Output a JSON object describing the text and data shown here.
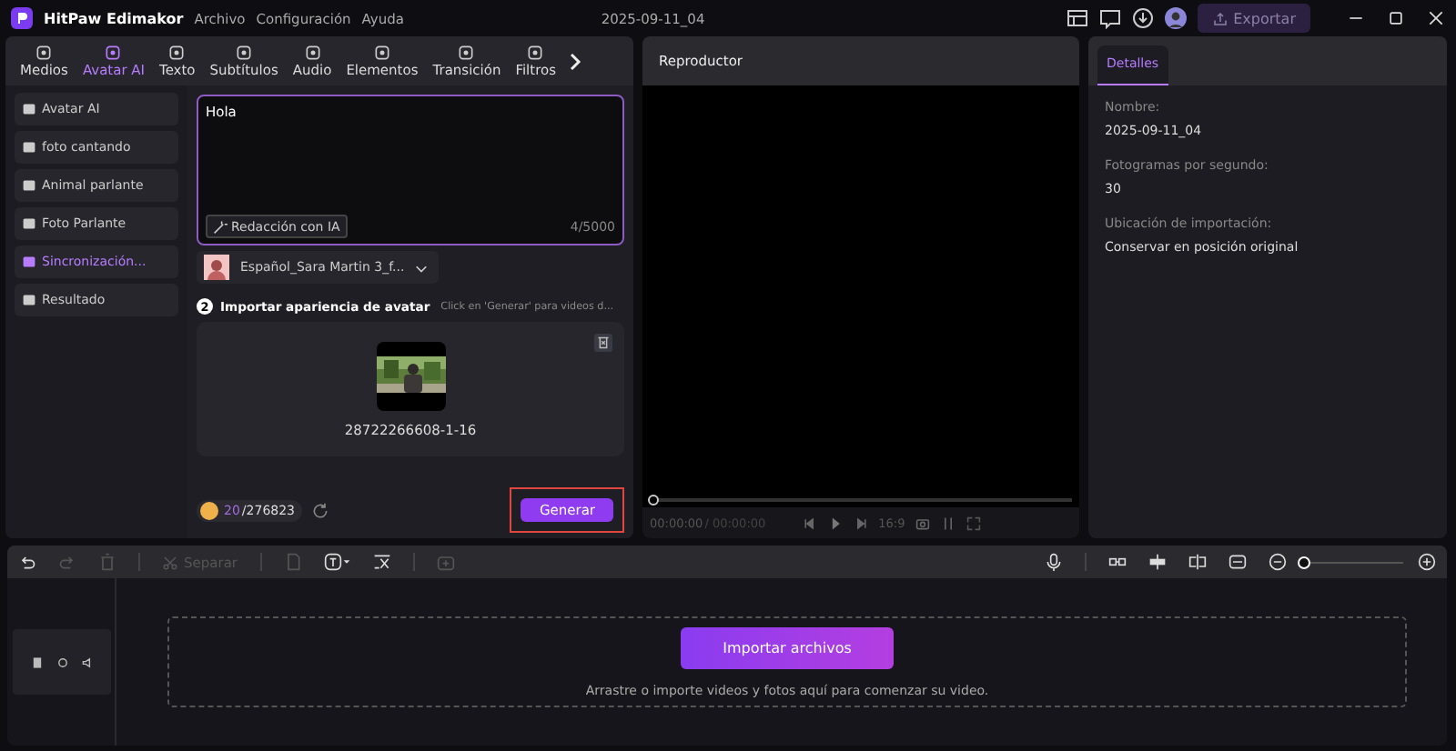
{
  "app": {
    "name": "HitPaw Edimakor",
    "menu": [
      "Archivo",
      "Configuración",
      "Ayuda"
    ],
    "project": "2025-09-11_04",
    "export": "Exportar"
  },
  "tabs": [
    {
      "label": "Medios",
      "selected": false
    },
    {
      "label": "Avatar AI",
      "selected": true
    },
    {
      "label": "Texto",
      "selected": false
    },
    {
      "label": "Subtítulos",
      "selected": false
    },
    {
      "label": "Audio",
      "selected": false
    },
    {
      "label": "Elementos",
      "selected": false
    },
    {
      "label": "Transición",
      "selected": false
    },
    {
      "label": "Filtros",
      "selected": false
    }
  ],
  "sidebar": [
    {
      "label": "Avatar AI",
      "selected": false
    },
    {
      "label": "foto cantando",
      "selected": false
    },
    {
      "label": "Animal parlante",
      "selected": false
    },
    {
      "label": "Foto Parlante",
      "selected": false
    },
    {
      "label": "Sincronización...",
      "selected": true
    },
    {
      "label": "Resultado",
      "selected": false
    }
  ],
  "script": {
    "value": "Hola",
    "ai_button": "Redacción con IA",
    "count": "4/5000"
  },
  "voice": {
    "name": "Español_Sara Martin 3_f..."
  },
  "step": {
    "number": "2",
    "title": "Importar apariencia de avatar",
    "hint": "Click en 'Generar' para videos d..."
  },
  "media": {
    "kind": "picture",
    "filename": "28722266608-1-16"
  },
  "credits": {
    "used": "20",
    "total": "/276823"
  },
  "generate": "Generar",
  "player": {
    "title": "Reproductor",
    "time": "00:00:00",
    "duration": "/ 00:00:00",
    "ratio": "16:9",
    "level": 0
  },
  "details": {
    "tab": "Detalles",
    "fields": [
      {
        "label": "Nombre:",
        "value": "2025-09-11_04"
      },
      {
        "label": "Fotogramas por segundo:",
        "value": "30"
      },
      {
        "label": "Ubicación de importación:",
        "value": "Conservar en posición original"
      }
    ]
  },
  "timeline": {
    "split": "Separar",
    "import": "Importar archivos",
    "hint": "Arrastre o importe videos y fotos aquí para comenzar su video.",
    "zoom": {
      "level": 0.02
    }
  }
}
